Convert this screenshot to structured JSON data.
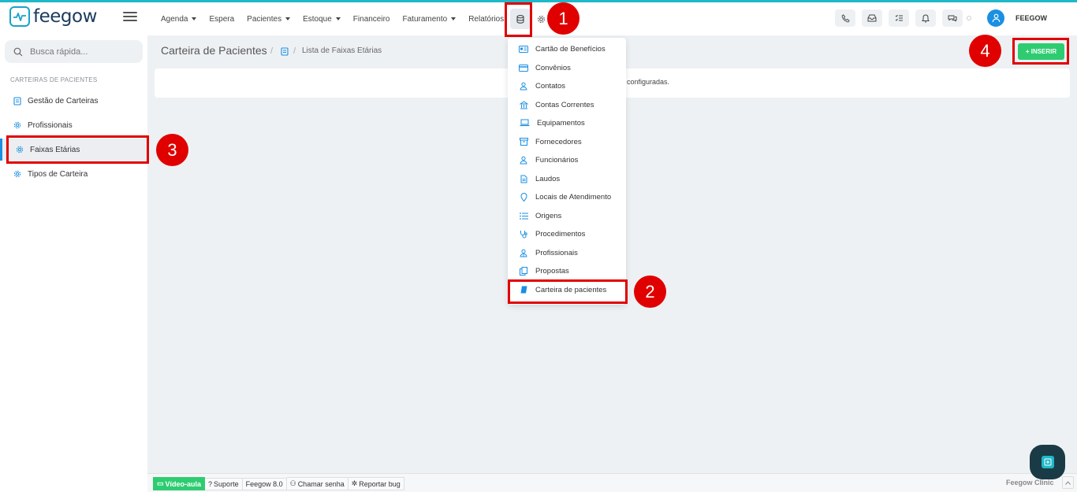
{
  "app": {
    "logo_text": "feegow",
    "user_name": "FEEGOW"
  },
  "nav": {
    "agenda": "Agenda",
    "espera": "Espera",
    "pacientes": "Pacientes",
    "estoque": "Estoque",
    "financeiro": "Financeiro",
    "faturamento": "Faturamento",
    "relatorios": "Relatórios"
  },
  "sidebar": {
    "search_placeholder": "Busca rápida...",
    "heading": "CARTEIRAS DE PACIENTES",
    "items": [
      {
        "label": "Gestão de Carteiras"
      },
      {
        "label": "Profissionais"
      },
      {
        "label": "Faixas Etárias"
      },
      {
        "label": "Tipos de Carteira"
      }
    ]
  },
  "breadcrumb": {
    "title": "Carteira de Pacientes",
    "separator": "/",
    "current": "Lista de Faixas Etárias"
  },
  "panel": {
    "message": "configuradas."
  },
  "buttons": {
    "inserir": "+ INSERIR"
  },
  "dropdown": {
    "items": [
      {
        "label": "Cartão de Benefícios"
      },
      {
        "label": "Convênios"
      },
      {
        "label": "Contatos"
      },
      {
        "label": "Contas Correntes"
      },
      {
        "label": "Equipamentos"
      },
      {
        "label": "Fornecedores"
      },
      {
        "label": "Funcionários"
      },
      {
        "label": "Laudos"
      },
      {
        "label": "Locais de Atendimento"
      },
      {
        "label": "Origens"
      },
      {
        "label": "Procedimentos"
      },
      {
        "label": "Profissionais"
      },
      {
        "label": "Propostas"
      },
      {
        "label": "Carteira de pacientes"
      }
    ]
  },
  "annotations": {
    "one": "1",
    "two": "2",
    "three": "3",
    "four": "4"
  },
  "footer": {
    "video": "Vídeo-aula",
    "suporte": "Suporte",
    "version": "Feegow 8.0",
    "chamar": "Chamar senha",
    "reportar": "Reportar bug",
    "clinic": "Feegow Clinic"
  },
  "colors": {
    "accent": "#1a8fe3",
    "teal": "#1fb8c8",
    "green": "#2ecc71",
    "annotation_red": "#e00000",
    "logo_text": "#1a3b5c"
  }
}
